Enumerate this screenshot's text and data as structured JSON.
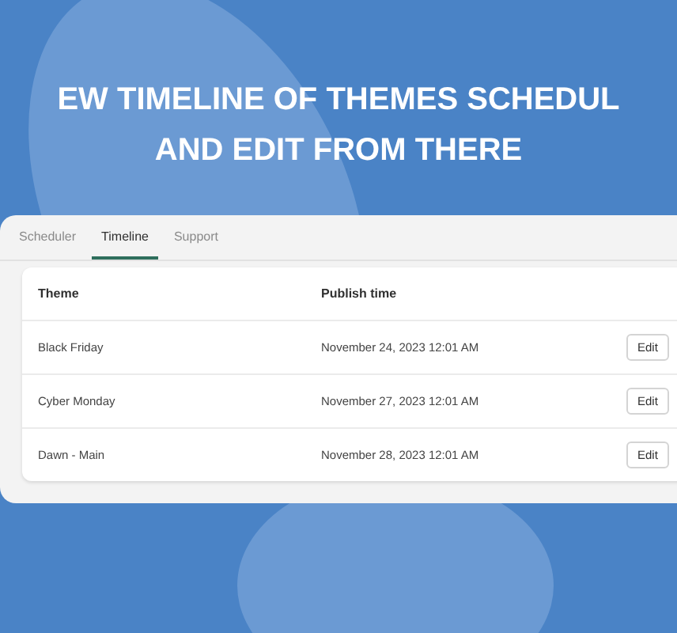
{
  "headline": [
    "EW TIMELINE OF THEMES SCHEDUL",
    "AND EDIT FROM THERE"
  ],
  "tabs": [
    {
      "label": "Scheduler",
      "selected": false
    },
    {
      "label": "Timeline",
      "selected": true
    },
    {
      "label": "Support",
      "selected": false
    }
  ],
  "table": {
    "columns": [
      "Theme",
      "Publish time"
    ],
    "rows": [
      {
        "theme": "Black Friday",
        "publish_time": "November 24, 2023 12:01 AM",
        "action": "Edit"
      },
      {
        "theme": "Cyber Monday",
        "publish_time": "November 27, 2023 12:01 AM",
        "action": "Edit"
      },
      {
        "theme": "Dawn - Main",
        "publish_time": "November 28, 2023 12:01 AM",
        "action": "Edit"
      }
    ]
  }
}
